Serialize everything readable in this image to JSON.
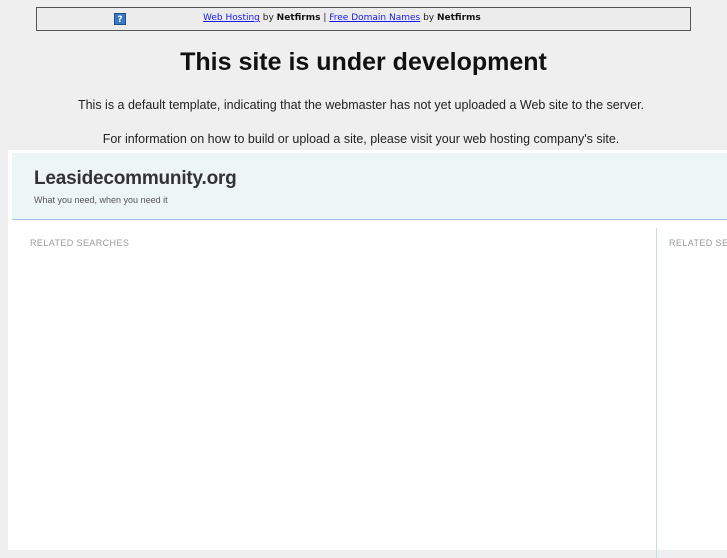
{
  "topbar": {
    "help_icon": "question-icon",
    "link1": "Web Hosting",
    "by1": " by ",
    "brand1": "Netfirms",
    "sep": " | ",
    "link2": "Free Domain Names",
    "by2": " by ",
    "brand2": "Netfirms"
  },
  "main": {
    "title": "This site is under development",
    "line1": "This is a default template, indicating that the webmaster has not yet uploaded a Web site to the server.",
    "line2": "For information on how to build or upload a site, please visit your web hosting company's site."
  },
  "parked": {
    "site_name": "Leasidecommunity.org",
    "tagline": "What you need, when you need it",
    "left_heading": "RELATED SEARCHES",
    "right_heading": "RELATED SEARCHES"
  }
}
